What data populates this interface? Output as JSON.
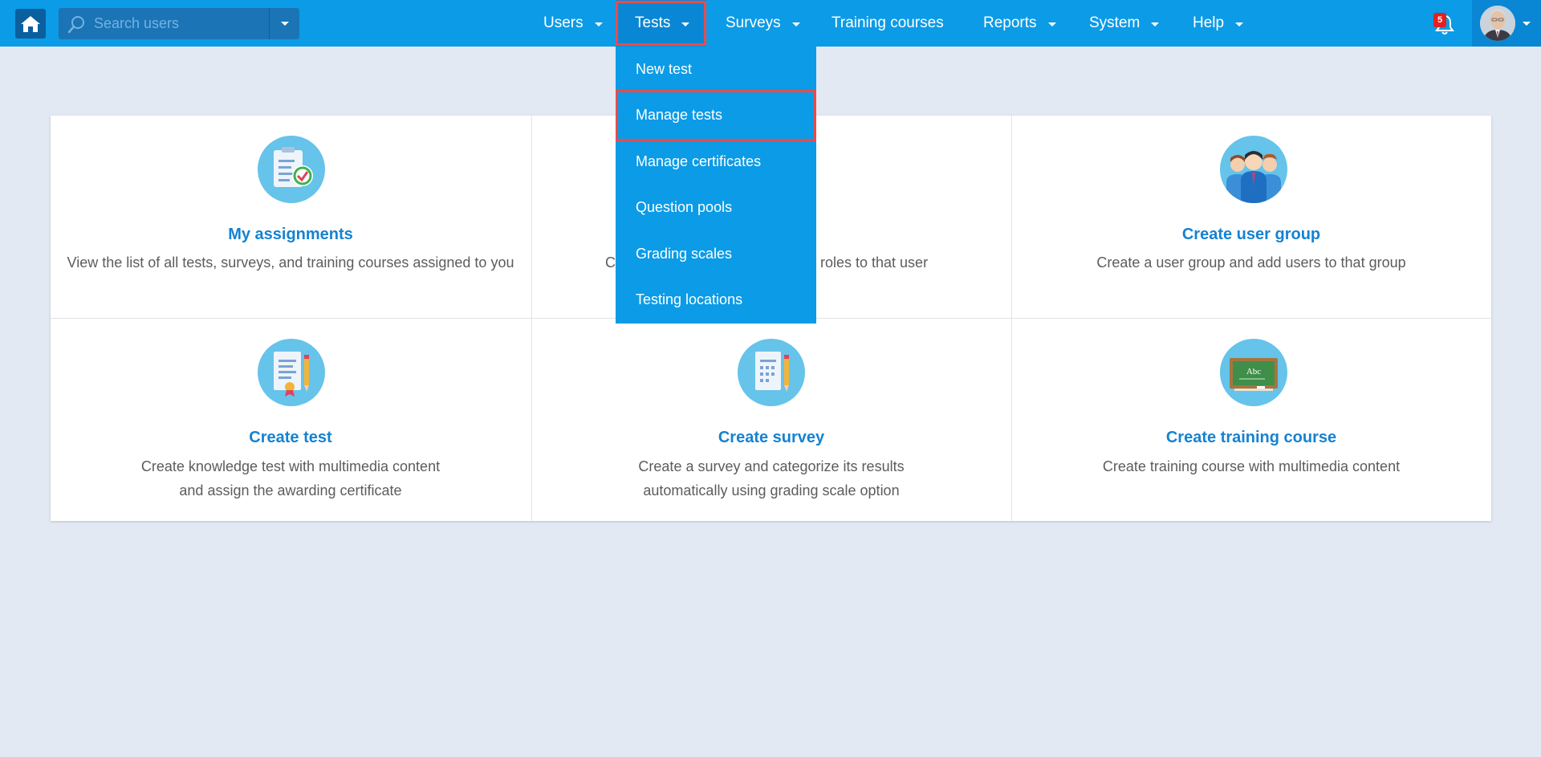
{
  "search": {
    "placeholder": "Search users"
  },
  "nav": {
    "users": "Users",
    "tests": "Tests",
    "surveys": "Surveys",
    "training_courses": "Training courses",
    "reports": "Reports",
    "system": "System",
    "help": "Help"
  },
  "notifications": {
    "count": "5"
  },
  "tests_menu": {
    "items": [
      {
        "label": "New test"
      },
      {
        "label": "Manage tests"
      },
      {
        "label": "Manage certificates"
      },
      {
        "label": "Question pools"
      },
      {
        "label": "Grading scales"
      },
      {
        "label": "Testing locations"
      }
    ]
  },
  "cards": {
    "my_assignments": {
      "title": "My assignments",
      "desc": "View the list of all tests, surveys, and training courses assigned to you"
    },
    "create_user_partial": {
      "desc_left": "C",
      "desc_right": "r roles to that user"
    },
    "create_user_group": {
      "title": "Create user group",
      "desc": "Create a user group and add users to that group"
    },
    "create_test": {
      "title": "Create test",
      "desc_line1": "Create knowledge test with multimedia content",
      "desc_line2": "and assign the awarding certificate"
    },
    "create_survey": {
      "title": "Create survey",
      "desc_line1": "Create a survey and categorize its results",
      "desc_line2": "automatically using grading scale option"
    },
    "create_training_course": {
      "title": "Create training course",
      "desc": "Create training course with multimedia content"
    }
  },
  "icons": {
    "home": "home-icon",
    "search": "search-icon",
    "bell": "bell-icon",
    "avatar": "user-avatar"
  },
  "colors": {
    "topbar": "#0c9be6",
    "active_nav": "#0a87d4",
    "highlight": "#e84c4c",
    "card_title": "#1582d2",
    "background": "#e3e9f3"
  }
}
